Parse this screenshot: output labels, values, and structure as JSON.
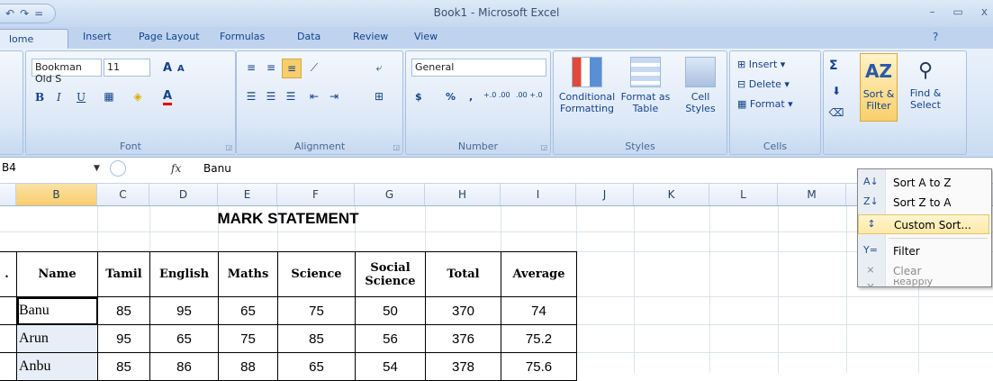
{
  "window": {
    "title": "Book1 - Microsoft Excel"
  },
  "qat": {
    "undo": "↶",
    "redo": "↷",
    "more": "="
  },
  "window_controls": {
    "minimize": "–",
    "restore": "▭",
    "close": "x"
  },
  "tabs": [
    "Home",
    "Insert",
    "Page Layout",
    "Formulas",
    "Data",
    "Review",
    "View"
  ],
  "tab_home_label": "lome",
  "ribbon": {
    "font": {
      "name": "Bookman Old S",
      "size": "11",
      "label": "Font",
      "bold": "B",
      "italic": "I",
      "underline": "U",
      "grow": "A",
      "shrink": "A",
      "color": "A"
    },
    "alignment": {
      "label": "Alignment"
    },
    "number": {
      "format": "General",
      "label": "Number",
      "currency": "$",
      "percent": "%",
      "comma": ",",
      "inc": "+.0 .00",
      "dec": ".00 +.0"
    },
    "styles": {
      "label": "Styles",
      "conditional": "Conditional Formatting",
      "format_table": "Format as Table",
      "cell_styles": "Cell Styles"
    },
    "cells": {
      "label": "Cells",
      "insert": "Insert",
      "delete": "Delete",
      "format": "Format"
    },
    "editing": {
      "sum": "Σ",
      "sort_filter": "Sort & Filter",
      "find_select": "Find & Select"
    }
  },
  "formula_bar": {
    "name_box": "B4",
    "fx": "fx",
    "value": "Banu"
  },
  "columns": [
    "B",
    "C",
    "D",
    "E",
    "F",
    "G",
    "H",
    "I",
    "J",
    "K",
    "L",
    "M"
  ],
  "sheet": {
    "title": "MARK STATEMENT",
    "headers": [
      ".",
      "Name",
      "Tamil",
      "English",
      "Maths",
      "Science",
      "Social Science",
      "Total",
      "Average"
    ],
    "rows": [
      [
        "",
        "Banu",
        "85",
        "95",
        "65",
        "75",
        "50",
        "370",
        "74"
      ],
      [
        "",
        "Arun",
        "95",
        "65",
        "75",
        "85",
        "56",
        "376",
        "75.2"
      ],
      [
        "",
        "Anbu",
        "85",
        "86",
        "88",
        "65",
        "54",
        "378",
        "75.6"
      ]
    ]
  },
  "sort_menu": {
    "items": [
      {
        "icon": "A↓",
        "label": "Sort A to Z"
      },
      {
        "icon": "Z↓",
        "label": "Sort Z to A"
      },
      {
        "icon": "↕",
        "label": "Custom Sort..."
      },
      {
        "icon": "Y=",
        "label": "Filter"
      },
      {
        "icon": "⨯",
        "label": "Clear"
      },
      {
        "icon": "Y",
        "label": "Reapply"
      }
    ]
  }
}
